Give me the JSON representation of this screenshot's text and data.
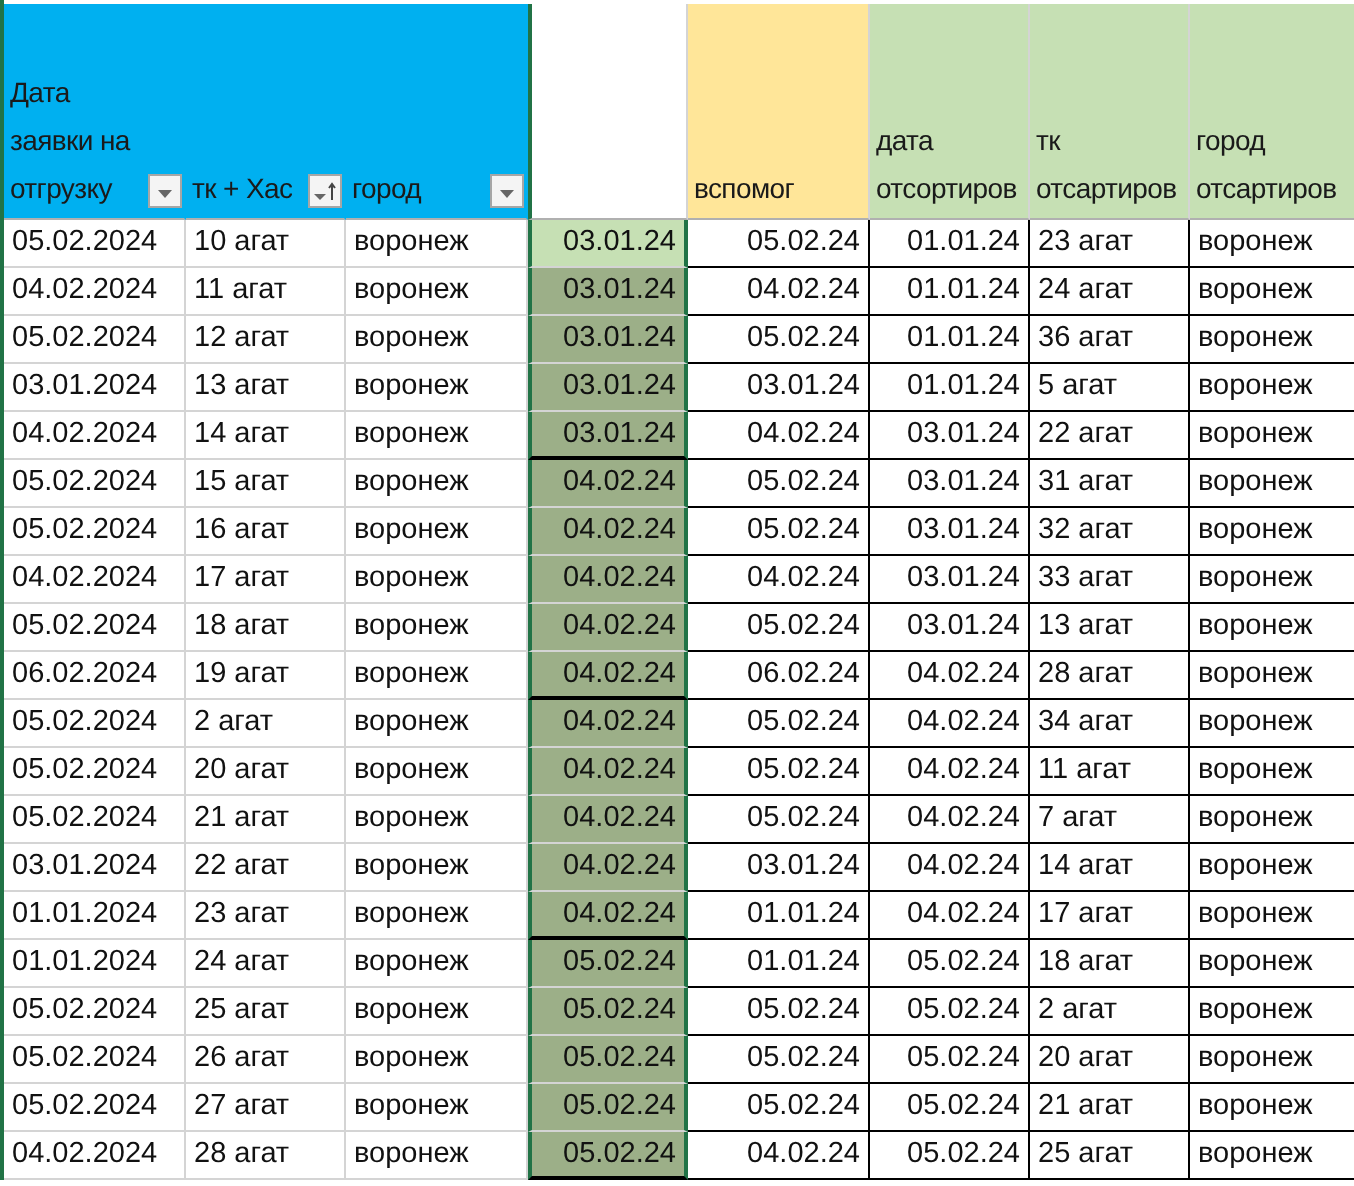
{
  "columns": [
    {
      "label": "Дата заявки на отгрузку",
      "kind": "source",
      "filter": true,
      "sorted": false
    },
    {
      "label": "тк + Хас",
      "kind": "source",
      "filter": true,
      "sorted": true
    },
    {
      "label": "город",
      "kind": "source",
      "filter": true,
      "sorted": false
    },
    {
      "kind": "blank"
    },
    {
      "label": "вспомог",
      "kind": "helper"
    },
    {
      "label": "дата отсортиров",
      "kind": "sorted"
    },
    {
      "label": "тк отсартиров",
      "kind": "sorted"
    },
    {
      "label": "город отсартиров",
      "kind": "sorted"
    }
  ],
  "rows": [
    {
      "cells": [
        "05.02.2024",
        "10 агат",
        "воронеж",
        "03.01.24",
        "05.02.24",
        "01.01.24",
        "23 агат",
        "воронеж"
      ],
      "selected": true,
      "group_end": false
    },
    {
      "cells": [
        "04.02.2024",
        "11 агат",
        "воронеж",
        "03.01.24",
        "04.02.24",
        "01.01.24",
        "24 агат",
        "воронеж"
      ],
      "selected": false,
      "group_end": false
    },
    {
      "cells": [
        "05.02.2024",
        "12 агат",
        "воронеж",
        "03.01.24",
        "05.02.24",
        "01.01.24",
        "36 агат",
        "воронеж"
      ],
      "selected": false,
      "group_end": false
    },
    {
      "cells": [
        "03.01.2024",
        "13 агат",
        "воронеж",
        "03.01.24",
        "03.01.24",
        "01.01.24",
        "5 агат",
        "воронеж"
      ],
      "selected": false,
      "group_end": false
    },
    {
      "cells": [
        "04.02.2024",
        "14 агат",
        "воронеж",
        "03.01.24",
        "04.02.24",
        "03.01.24",
        "22 агат",
        "воронеж"
      ],
      "selected": false,
      "group_end": true
    },
    {
      "cells": [
        "05.02.2024",
        "15 агат",
        "воронеж",
        "04.02.24",
        "05.02.24",
        "03.01.24",
        "31 агат",
        "воронеж"
      ],
      "selected": false,
      "group_end": false
    },
    {
      "cells": [
        "05.02.2024",
        "16 агат",
        "воронеж",
        "04.02.24",
        "05.02.24",
        "03.01.24",
        "32 агат",
        "воронеж"
      ],
      "selected": false,
      "group_end": false
    },
    {
      "cells": [
        "04.02.2024",
        "17 агат",
        "воронеж",
        "04.02.24",
        "04.02.24",
        "03.01.24",
        "33 агат",
        "воронеж"
      ],
      "selected": false,
      "group_end": false
    },
    {
      "cells": [
        "05.02.2024",
        "18 агат",
        "воронеж",
        "04.02.24",
        "05.02.24",
        "03.01.24",
        "13 агат",
        "воронеж"
      ],
      "selected": false,
      "group_end": false
    },
    {
      "cells": [
        "06.02.2024",
        "19 агат",
        "воронеж",
        "04.02.24",
        "06.02.24",
        "04.02.24",
        "28 агат",
        "воронеж"
      ],
      "selected": false,
      "group_end": true
    },
    {
      "cells": [
        "05.02.2024",
        "2 агат",
        "воронеж",
        "04.02.24",
        "05.02.24",
        "04.02.24",
        "34 агат",
        "воронеж"
      ],
      "selected": false,
      "group_end": false
    },
    {
      "cells": [
        "05.02.2024",
        "20 агат",
        "воронеж",
        "04.02.24",
        "05.02.24",
        "04.02.24",
        "11 агат",
        "воронеж"
      ],
      "selected": false,
      "group_end": false
    },
    {
      "cells": [
        "05.02.2024",
        "21 агат",
        "воронеж",
        "04.02.24",
        "05.02.24",
        "04.02.24",
        "7 агат",
        "воронеж"
      ],
      "selected": false,
      "group_end": false
    },
    {
      "cells": [
        "03.01.2024",
        "22 агат",
        "воронеж",
        "04.02.24",
        "03.01.24",
        "04.02.24",
        "14 агат",
        "воронеж"
      ],
      "selected": false,
      "group_end": false
    },
    {
      "cells": [
        "01.01.2024",
        "23 агат",
        "воронеж",
        "04.02.24",
        "01.01.24",
        "04.02.24",
        "17 агат",
        "воронеж"
      ],
      "selected": false,
      "group_end": true
    },
    {
      "cells": [
        "01.01.2024",
        "24 агат",
        "воронеж",
        "05.02.24",
        "01.01.24",
        "05.02.24",
        "18 агат",
        "воронеж"
      ],
      "selected": false,
      "group_end": false
    },
    {
      "cells": [
        "05.02.2024",
        "25 агат",
        "воронеж",
        "05.02.24",
        "05.02.24",
        "05.02.24",
        "2 агат",
        "воронеж"
      ],
      "selected": false,
      "group_end": false
    },
    {
      "cells": [
        "05.02.2024",
        "26 агат",
        "воронеж",
        "05.02.24",
        "05.02.24",
        "05.02.24",
        "20 агат",
        "воронеж"
      ],
      "selected": false,
      "group_end": false
    },
    {
      "cells": [
        "05.02.2024",
        "27 агат",
        "воронеж",
        "05.02.24",
        "05.02.24",
        "05.02.24",
        "21 агат",
        "воронеж"
      ],
      "selected": false,
      "group_end": false
    },
    {
      "cells": [
        "04.02.2024",
        "28 агат",
        "воронеж",
        "05.02.24",
        "04.02.24",
        "05.02.24",
        "25 агат",
        "воронеж"
      ],
      "selected": false,
      "group_end": true
    }
  ]
}
